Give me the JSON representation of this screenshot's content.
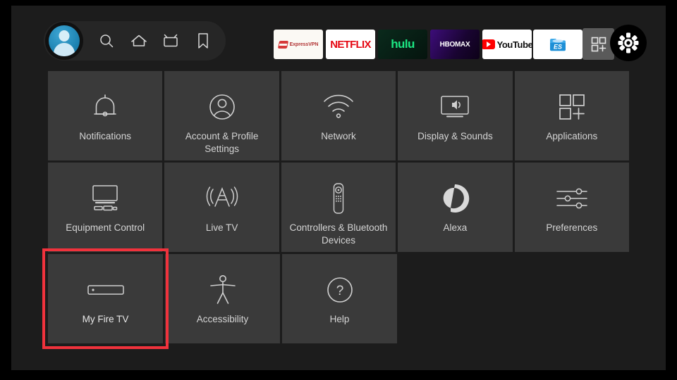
{
  "screen": {
    "device": "Fire TV Settings",
    "background_color": "#1c1c1c",
    "tile_color": "#3a3a3a",
    "highlight_color": "#f0323c"
  },
  "topbar": {
    "profile_label": "Profile",
    "nav_items": [
      {
        "name": "search",
        "label": "Search"
      },
      {
        "name": "home",
        "label": "Home"
      },
      {
        "name": "live-tv",
        "label": "Live TV"
      },
      {
        "name": "bookmark",
        "label": "Your Stuff"
      }
    ],
    "apps": [
      {
        "name": "expressvpn",
        "label": "ExpressVPN"
      },
      {
        "name": "netflix",
        "label": "NETFLIX"
      },
      {
        "name": "hulu",
        "label": "hulu"
      },
      {
        "name": "hbomax",
        "label": "HBOMAX"
      },
      {
        "name": "youtube",
        "label": "YouTube"
      },
      {
        "name": "es-file-explorer",
        "label": "ES"
      }
    ],
    "apps_grid_label": "All Apps",
    "settings_label": "Settings"
  },
  "grid": {
    "rows": [
      [
        {
          "icon": "bell-icon",
          "label": "Notifications",
          "selected": false
        },
        {
          "icon": "account-icon",
          "label": "Account & Profile Settings",
          "selected": false
        },
        {
          "icon": "wifi-icon",
          "label": "Network",
          "selected": false
        },
        {
          "icon": "display-sound-icon",
          "label": "Display & Sounds",
          "selected": false
        },
        {
          "icon": "applications-icon",
          "label": "Applications",
          "selected": false
        }
      ],
      [
        {
          "icon": "equipment-control-icon",
          "label": "Equipment Control",
          "selected": false
        },
        {
          "icon": "live-tv-antenna-icon",
          "label": "Live TV",
          "selected": false
        },
        {
          "icon": "remote-icon",
          "label": "Controllers & Bluetooth Devices",
          "selected": false
        },
        {
          "icon": "alexa-icon",
          "label": "Alexa",
          "selected": false
        },
        {
          "icon": "preferences-icon",
          "label": "Preferences",
          "selected": false
        }
      ],
      [
        {
          "icon": "fire-tv-stick-icon",
          "label": "My Fire TV",
          "selected": true
        },
        {
          "icon": "accessibility-icon",
          "label": "Accessibility",
          "selected": false
        },
        {
          "icon": "help-icon",
          "label": "Help",
          "selected": false
        }
      ]
    ]
  }
}
